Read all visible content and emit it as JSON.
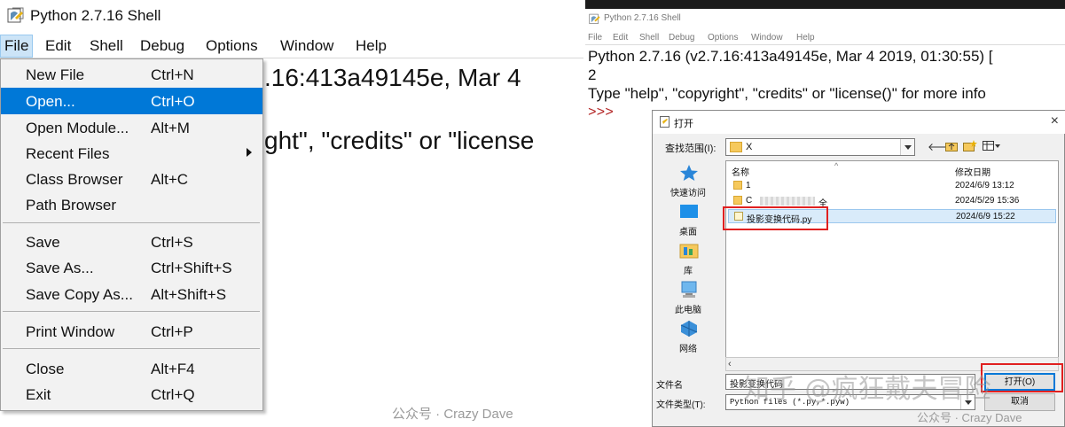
{
  "left": {
    "window_title": "Python 2.7.16 Shell",
    "menu": [
      "File",
      "Edit",
      "Shell",
      "Debug",
      "Options",
      "Window",
      "Help"
    ],
    "shell_lines": [
      ".16:413a49145e, Mar  4",
      "ght\", \"credits\" or \"license"
    ],
    "file_menu": [
      {
        "label": "New File",
        "accel": "Ctrl+N"
      },
      {
        "label": "Open...",
        "accel": "Ctrl+O"
      },
      {
        "label": "Open Module...",
        "accel": "Alt+M"
      },
      {
        "label": "Recent Files",
        "accel": ""
      },
      {
        "label": "Class Browser",
        "accel": "Alt+C"
      },
      {
        "label": "Path Browser",
        "accel": ""
      },
      {
        "label": "Save",
        "accel": "Ctrl+S"
      },
      {
        "label": "Save As...",
        "accel": "Ctrl+Shift+S"
      },
      {
        "label": "Save Copy As...",
        "accel": "Alt+Shift+S"
      },
      {
        "label": "Print Window",
        "accel": "Ctrl+P"
      },
      {
        "label": "Close",
        "accel": "Alt+F4"
      },
      {
        "label": "Exit",
        "accel": "Ctrl+Q"
      }
    ],
    "watermark": "公众号 · Crazy Dave"
  },
  "right": {
    "window_title": "Python 2.7.16 Shell",
    "menu": [
      "File",
      "Edit",
      "Shell",
      "Debug",
      "Options",
      "Window",
      "Help"
    ],
    "shell_lines": [
      "Python 2.7.16 (v2.7.16:413a49145e, Mar  4 2019, 01:30:55) [",
      "2",
      "Type \"help\", \"copyright\", \"credits\" or \"license()\" for more info"
    ],
    "prompt": ">>>",
    "dialog": {
      "title": "打开",
      "close": "×",
      "look_in_label": "查找范围(I):",
      "look_in_value": "X",
      "places": [
        "快速访问",
        "桌面",
        "库",
        "此电脑",
        "网络"
      ],
      "col_name": "名称",
      "col_date": "修改日期",
      "files": [
        {
          "name": "1",
          "date": "2024/6/9 13:12"
        },
        {
          "name": "C",
          "name_tail": "全",
          "date": "2024/5/29 15:36"
        },
        {
          "name": "投影变换代码.py",
          "date": "2024/6/9 15:22"
        }
      ],
      "file_name_label": "文件名",
      "file_name_value": "投影变换代码",
      "file_type_label": "文件类型(T):",
      "file_type_value": "Python files (*.py,*.pyw)",
      "open_button": "打开(O)",
      "cancel_button": "取消"
    },
    "watermark_big": "知乎 @疯狂戴夫冒险",
    "watermark": "公众号 · Crazy Dave"
  },
  "colors": {
    "highlight": "#0078d7",
    "redbox": "#e02020",
    "prompt": "#b22222"
  }
}
